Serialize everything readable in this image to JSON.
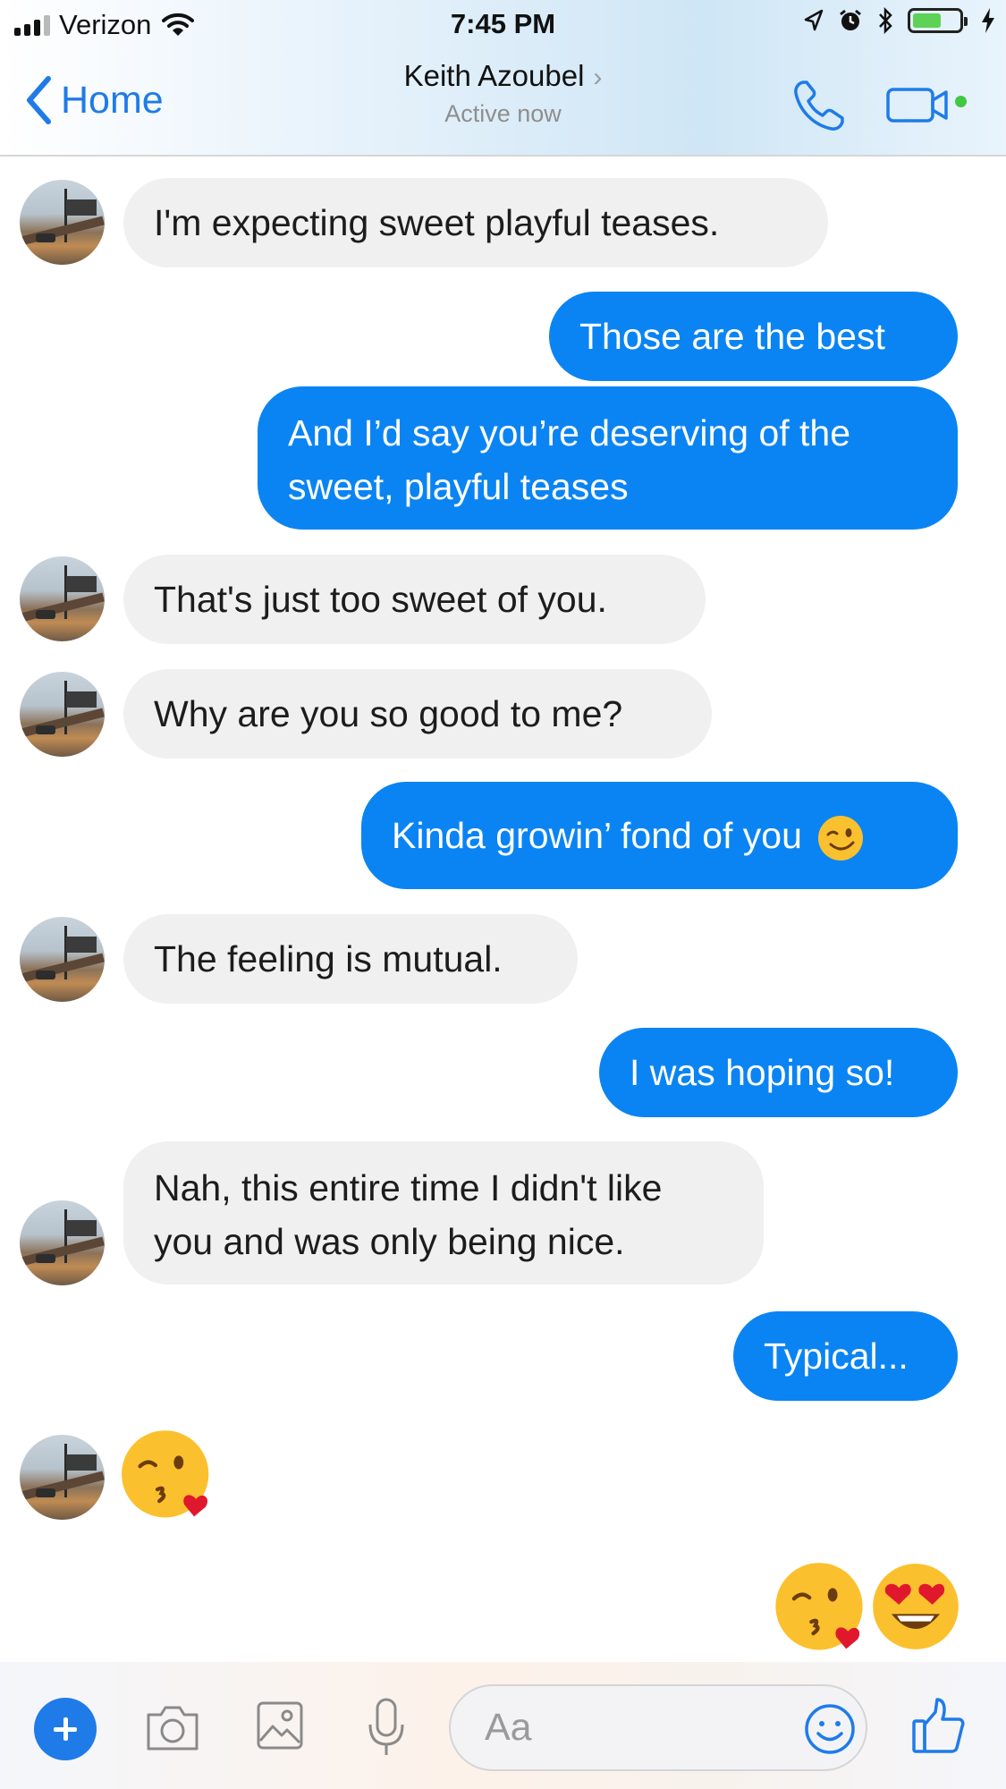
{
  "status_bar": {
    "carrier": "Verizon",
    "time": "7:45 PM",
    "icons": [
      "signal-bars",
      "wifi-icon",
      "location-arrow-icon",
      "alarm-icon",
      "bluetooth-icon",
      "battery-icon",
      "charging-bolt-icon"
    ]
  },
  "header": {
    "back_label": "Home",
    "contact_name": "Keith Azoubel",
    "contact_status": "Active now",
    "chevron": "›",
    "icons": [
      "back-chevron-icon",
      "phone-icon",
      "video-camera-icon",
      "online-dot"
    ]
  },
  "messages": [
    {
      "sender": "them",
      "text": "I'm expecting sweet playful teases."
    },
    {
      "sender": "me",
      "text": "Those are the best"
    },
    {
      "sender": "me",
      "line1": "And I’d say you’re deserving of the",
      "line2": "sweet, playful teases"
    },
    {
      "sender": "them",
      "text": "That's just too sweet of you."
    },
    {
      "sender": "them",
      "text": "Why are you so good to me?"
    },
    {
      "sender": "me",
      "text": "Kinda growin’ fond of you",
      "emoji": "winking-face-icon"
    },
    {
      "sender": "them",
      "text": "The feeling is mutual."
    },
    {
      "sender": "me",
      "text": "I was hoping so!"
    },
    {
      "sender": "them",
      "line1": "Nah, this entire time I didn't like",
      "line2": "you and was only being nice."
    },
    {
      "sender": "me",
      "text": "Typical..."
    },
    {
      "sender": "them",
      "emoji": "face-blowing-kiss-icon"
    },
    {
      "sender": "me",
      "emoji": [
        "face-blowing-kiss-icon",
        "heart-eyes-icon"
      ]
    }
  ],
  "composer": {
    "placeholder": "Aa",
    "icons": [
      "plus-icon",
      "camera-icon",
      "gallery-icon",
      "microphone-icon",
      "emoji-smile-icon",
      "thumbs-up-icon"
    ]
  },
  "colors": {
    "accent": "#1f7be8",
    "outgoing_bubble": "#0b84f3",
    "incoming_bubble": "#f1f0f0",
    "online": "#42c742",
    "battery": "#5ed157"
  }
}
